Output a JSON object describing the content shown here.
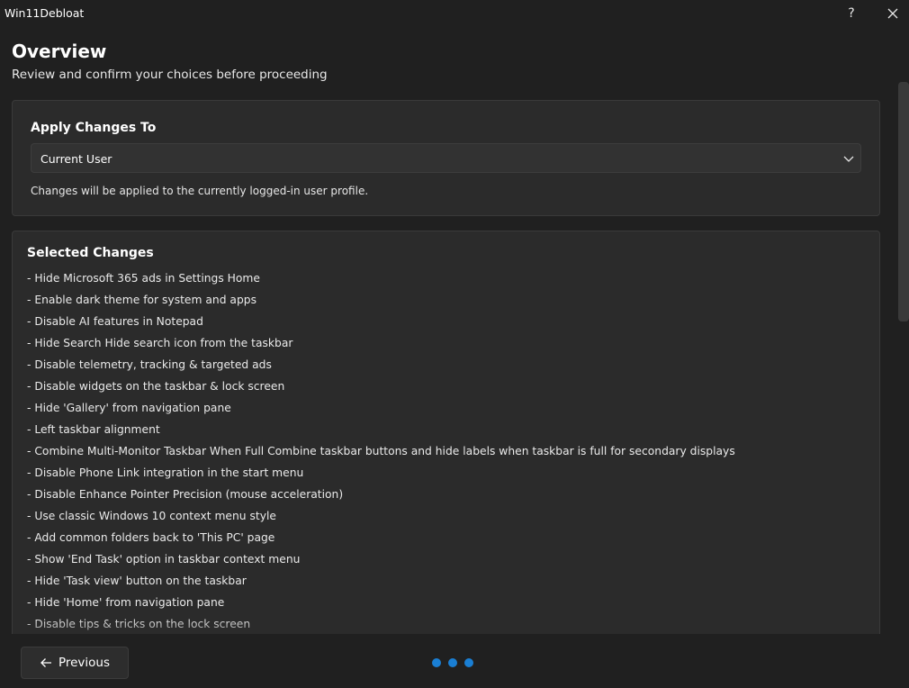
{
  "app": {
    "title": "Win11Debloat",
    "help_label": "?"
  },
  "header": {
    "title": "Overview",
    "subtitle": "Review and confirm your choices before proceeding"
  },
  "apply": {
    "title": "Apply Changes To",
    "selected": "Current User",
    "description": "Changes will be applied to the currently logged-in user profile."
  },
  "changes": {
    "title": "Selected Changes",
    "items": [
      "- Hide Microsoft 365 ads in Settings Home",
      "- Enable dark theme for system and apps",
      "- Disable AI features in Notepad",
      "- Hide Search Hide search icon from the taskbar",
      "- Disable telemetry, tracking & targeted ads",
      "- Disable widgets on the taskbar & lock screen",
      "- Hide 'Gallery' from navigation pane",
      "- Left taskbar alignment",
      "- Combine Multi-Monitor Taskbar When Full Combine taskbar buttons and hide labels when taskbar is full for secondary displays",
      "- Disable Phone Link integration in the start menu",
      "- Disable Enhance Pointer Precision (mouse acceleration)",
      "- Use classic Windows 10 context menu style",
      "- Add common folders back to 'This PC' page",
      "- Show 'End Task' option in taskbar context menu",
      "- Hide 'Task view' button on the taskbar",
      "- Hide 'Home' from navigation pane",
      "- Disable tips & tricks on the lock screen"
    ]
  },
  "footer": {
    "previous_label": "Previous",
    "dots_count": 3
  },
  "colors": {
    "background": "#202020",
    "card": "#2b2b2b",
    "accent": "#1a7fd4"
  },
  "icons": {
    "close": "close-icon",
    "chevron": "chevron-down-icon",
    "back": "arrow-left-icon"
  }
}
